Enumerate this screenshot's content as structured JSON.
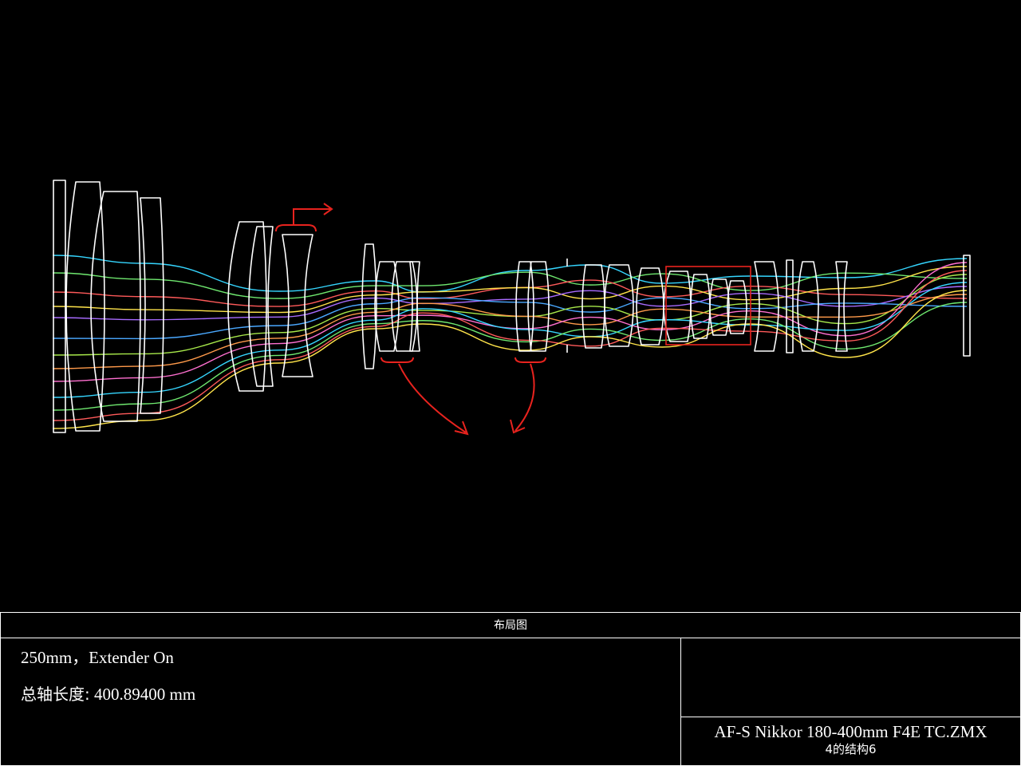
{
  "panel": {
    "title": "布局图",
    "configuration_label": "250mm，Extender On",
    "total_length_label": "总轴长度:",
    "total_length_value": "400.89400 mm",
    "file_name": "AF-S Nikkor 180-400mm F4E TC.ZMX",
    "config_note": "4的结构6"
  },
  "colors": {
    "background": "#000000",
    "lens_outline": "#ffffff",
    "annotation": "#e8231e",
    "rays": [
      "#35d6ff",
      "#6fe86f",
      "#ff5a5a",
      "#ffe44a",
      "#a86bff",
      "#4aa8ff",
      "#a7e84a",
      "#ff9a4a",
      "#ff6fd0"
    ]
  },
  "icons": {
    "ray_fan": "ray-lines",
    "lens_element": "lens-outline",
    "annotation_bracket": "bracket-arrow-icon",
    "annotation_box": "highlight-box"
  }
}
